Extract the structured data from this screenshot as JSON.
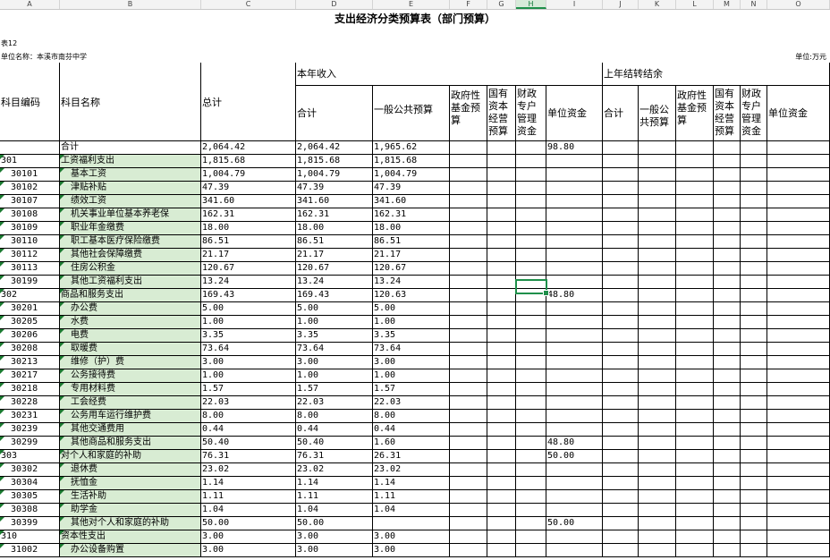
{
  "sheet": {
    "column_letters": [
      "A",
      "B",
      "C",
      "D",
      "E",
      "F",
      "G",
      "H",
      "I",
      "J",
      "K",
      "L",
      "M",
      "N",
      "O"
    ],
    "selected_column": "H",
    "title": "支出经济分类预算表（部门预算）",
    "table_no": "表12",
    "unit_name": "单位名称：本溪市南芬中学",
    "unit": "单位:万元"
  },
  "headers": {
    "code": "科目编码",
    "name": "科目名称",
    "total": "总计",
    "current_income": "本年收入",
    "prior_carryover": "上年结转结余",
    "sub": [
      "合计",
      "一般公共预算",
      "政府性基金预算",
      "国有资本经营预算",
      "财政专户管理资金",
      "单位资金"
    ],
    "sub_prev": [
      "合计",
      "一般公共预算",
      "政府性基金预算",
      "国有资本经营预算",
      "财政专户管理资金",
      "单位资金"
    ]
  },
  "rows": [
    {
      "code": "",
      "name": "合计",
      "total": "2,064.42",
      "sum": "2,064.42",
      "general": "1,965.62",
      "unitfund": "98.80"
    },
    {
      "code": "301",
      "name": "工资福利支出",
      "total": "1,815.68",
      "sum": "1,815.68",
      "general": "1,815.68",
      "unitfund": ""
    },
    {
      "code": "30101",
      "name": "基本工资",
      "total": "1,004.79",
      "sum": "1,004.79",
      "general": "1,004.79",
      "unitfund": ""
    },
    {
      "code": "30102",
      "name": "津贴补贴",
      "total": "47.39",
      "sum": "47.39",
      "general": "47.39",
      "unitfund": ""
    },
    {
      "code": "30107",
      "name": "绩效工资",
      "total": "341.60",
      "sum": "341.60",
      "general": "341.60",
      "unitfund": ""
    },
    {
      "code": "30108",
      "name": "机关事业单位基本养老保",
      "total": "162.31",
      "sum": "162.31",
      "general": "162.31",
      "unitfund": ""
    },
    {
      "code": "30109",
      "name": "职业年金缴费",
      "total": "18.00",
      "sum": "18.00",
      "general": "18.00",
      "unitfund": ""
    },
    {
      "code": "30110",
      "name": "职工基本医疗保险缴费",
      "total": "86.51",
      "sum": "86.51",
      "general": "86.51",
      "unitfund": ""
    },
    {
      "code": "30112",
      "name": "其他社会保障缴费",
      "total": "21.17",
      "sum": "21.17",
      "general": "21.17",
      "unitfund": ""
    },
    {
      "code": "30113",
      "name": "住房公积金",
      "total": "120.67",
      "sum": "120.67",
      "general": "120.67",
      "unitfund": ""
    },
    {
      "code": "30199",
      "name": "其他工资福利支出",
      "total": "13.24",
      "sum": "13.24",
      "general": "13.24",
      "unitfund": ""
    },
    {
      "code": "302",
      "name": "商品和服务支出",
      "total": "169.43",
      "sum": "169.43",
      "general": "120.63",
      "unitfund": "48.80"
    },
    {
      "code": "30201",
      "name": "办公费",
      "total": "5.00",
      "sum": "5.00",
      "general": "5.00",
      "unitfund": ""
    },
    {
      "code": "30205",
      "name": "水费",
      "total": "1.00",
      "sum": "1.00",
      "general": "1.00",
      "unitfund": ""
    },
    {
      "code": "30206",
      "name": "电费",
      "total": "3.35",
      "sum": "3.35",
      "general": "3.35",
      "unitfund": ""
    },
    {
      "code": "30208",
      "name": "取暖费",
      "total": "73.64",
      "sum": "73.64",
      "general": "73.64",
      "unitfund": ""
    },
    {
      "code": "30213",
      "name": "维修（护）费",
      "total": "3.00",
      "sum": "3.00",
      "general": "3.00",
      "unitfund": ""
    },
    {
      "code": "30217",
      "name": "公务接待费",
      "total": "1.00",
      "sum": "1.00",
      "general": "1.00",
      "unitfund": ""
    },
    {
      "code": "30218",
      "name": "专用材料费",
      "total": "1.57",
      "sum": "1.57",
      "general": "1.57",
      "unitfund": ""
    },
    {
      "code": "30228",
      "name": "工会经费",
      "total": "22.03",
      "sum": "22.03",
      "general": "22.03",
      "unitfund": ""
    },
    {
      "code": "30231",
      "name": "公务用车运行维护费",
      "total": "8.00",
      "sum": "8.00",
      "general": "8.00",
      "unitfund": ""
    },
    {
      "code": "30239",
      "name": "其他交通费用",
      "total": "0.44",
      "sum": "0.44",
      "general": "0.44",
      "unitfund": ""
    },
    {
      "code": "30299",
      "name": "其他商品和服务支出",
      "total": "50.40",
      "sum": "50.40",
      "general": "1.60",
      "unitfund": "48.80"
    },
    {
      "code": "303",
      "name": "对个人和家庭的补助",
      "total": "76.31",
      "sum": "76.31",
      "general": "26.31",
      "unitfund": "50.00"
    },
    {
      "code": "30302",
      "name": "退休费",
      "total": "23.02",
      "sum": "23.02",
      "general": "23.02",
      "unitfund": ""
    },
    {
      "code": "30304",
      "name": "抚恤金",
      "total": "1.14",
      "sum": "1.14",
      "general": "1.14",
      "unitfund": ""
    },
    {
      "code": "30305",
      "name": "生活补助",
      "total": "1.11",
      "sum": "1.11",
      "general": "1.11",
      "unitfund": ""
    },
    {
      "code": "30308",
      "name": "助学金",
      "total": "1.04",
      "sum": "1.04",
      "general": "1.04",
      "unitfund": ""
    },
    {
      "code": "30399",
      "name": "其他对个人和家庭的补助",
      "total": "50.00",
      "sum": "50.00",
      "general": "",
      "unitfund": "50.00"
    },
    {
      "code": "310",
      "name": "资本性支出",
      "total": "3.00",
      "sum": "3.00",
      "general": "3.00",
      "unitfund": ""
    },
    {
      "code": "31002",
      "name": "办公设备购置",
      "total": "3.00",
      "sum": "3.00",
      "general": "3.00",
      "unitfund": ""
    }
  ]
}
